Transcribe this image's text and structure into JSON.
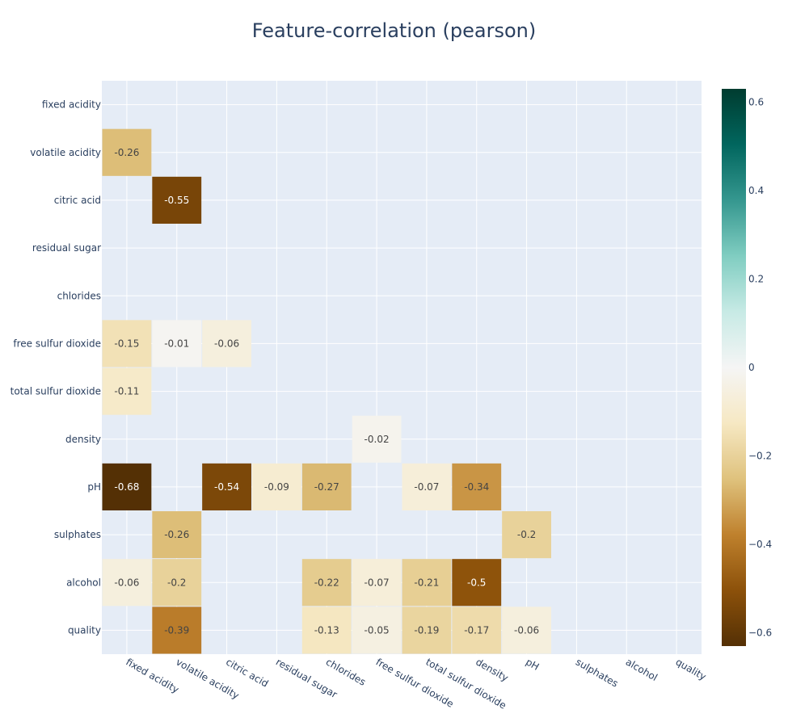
{
  "chart_data": {
    "type": "heatmap",
    "title": "Feature-correlation (pearson)",
    "xlabel": "",
    "ylabel": "",
    "x": [
      "fixed acidity",
      "volatile acidity",
      "citric acid",
      "residual sugar",
      "chlorides",
      "free sulfur dioxide",
      "total sulfur dioxide",
      "density",
      "pH",
      "sulphates",
      "alcohol",
      "quality"
    ],
    "y": [
      "fixed acidity",
      "volatile acidity",
      "citric acid",
      "residual sugar",
      "chlorides",
      "free sulfur dioxide",
      "total sulfur dioxide",
      "density",
      "pH",
      "sulphates",
      "alcohol",
      "quality"
    ],
    "z": [
      [
        null,
        null,
        null,
        null,
        null,
        null,
        null,
        null,
        null,
        null,
        null,
        null
      ],
      [
        -0.26,
        null,
        null,
        null,
        null,
        null,
        null,
        null,
        null,
        null,
        null,
        null
      ],
      [
        null,
        -0.55,
        null,
        null,
        null,
        null,
        null,
        null,
        null,
        null,
        null,
        null
      ],
      [
        null,
        null,
        null,
        null,
        null,
        null,
        null,
        null,
        null,
        null,
        null,
        null
      ],
      [
        null,
        null,
        null,
        null,
        null,
        null,
        null,
        null,
        null,
        null,
        null,
        null
      ],
      [
        -0.15,
        -0.01,
        -0.06,
        null,
        null,
        null,
        null,
        null,
        null,
        null,
        null,
        null
      ],
      [
        -0.11,
        null,
        null,
        null,
        null,
        null,
        null,
        null,
        null,
        null,
        null,
        null
      ],
      [
        null,
        null,
        null,
        null,
        null,
        -0.02,
        null,
        null,
        null,
        null,
        null,
        null
      ],
      [
        -0.68,
        null,
        -0.54,
        -0.09,
        -0.27,
        null,
        -0.07,
        -0.34,
        null,
        null,
        null,
        null
      ],
      [
        null,
        -0.26,
        null,
        null,
        null,
        null,
        null,
        null,
        -0.2,
        null,
        null,
        null
      ],
      [
        -0.06,
        -0.2,
        null,
        null,
        -0.22,
        -0.07,
        -0.21,
        -0.5,
        null,
        null,
        null,
        null
      ],
      [
        null,
        -0.39,
        null,
        null,
        -0.13,
        -0.05,
        -0.19,
        -0.17,
        -0.06,
        null,
        null,
        null
      ]
    ],
    "colorscale": "BrBG",
    "zrange": [
      -0.63,
      0.63
    ],
    "colorbar": {
      "ticks": [
        0.6,
        0.4,
        0.2,
        0,
        -0.2,
        -0.4,
        -0.6
      ],
      "tick_labels": [
        "0.6",
        "0.4",
        "0.2",
        "0",
        "−0.2",
        "−0.4",
        "−0.6"
      ],
      "placement": "right"
    },
    "grid": true,
    "xtick_angle": 30
  },
  "colors": {
    "plot_bg": "#e5ecf6",
    "grid": "#ffffff",
    "text": "#2a3f5f"
  }
}
